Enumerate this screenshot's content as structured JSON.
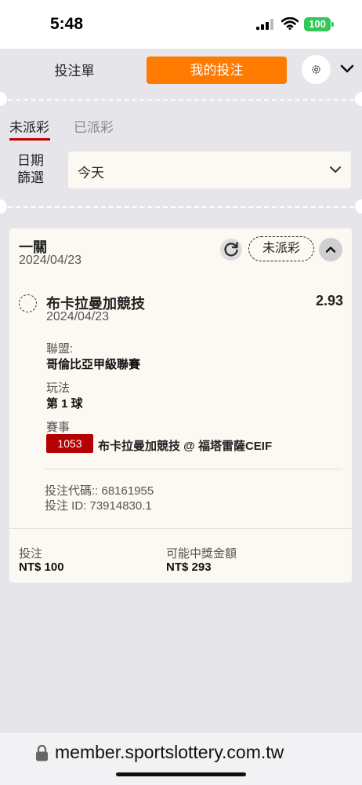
{
  "status_bar": {
    "time": "5:48",
    "battery": "100"
  },
  "tabs": {
    "bet_slip": "投注單",
    "my_bets": "我的投注"
  },
  "status_tabs": {
    "unsettled": "未派彩",
    "settled": "已派彩"
  },
  "date_filter": {
    "label": "日期篩選",
    "value": "今天"
  },
  "bet": {
    "type": "一關",
    "date": "2024/04/23",
    "status": "未派彩",
    "selection": {
      "name": "布卡拉曼加競技",
      "odds": "2.93",
      "date": "2024/04/23"
    },
    "league_label": "聯盟:",
    "league": "哥倫比亞甲級聯賽",
    "market_label": "玩法",
    "market": "第 1 球",
    "event_label": "賽事",
    "event_id": "1053",
    "event_name": "布卡拉曼加競技 @ 福塔雷薩CEIF",
    "bet_code": "投注代碼:: 68161955",
    "bet_id": "投注 ID: 73914830.1",
    "stake_label": "投注",
    "stake": "NT$ 100",
    "payout_label": "可能中獎金額",
    "payout": "NT$ 293"
  },
  "browser": {
    "url": "member.sportslottery.com.tw"
  },
  "colors": {
    "accent": "#ff7a00",
    "event_badge": "#b40000",
    "active_underline": "#c00000"
  }
}
